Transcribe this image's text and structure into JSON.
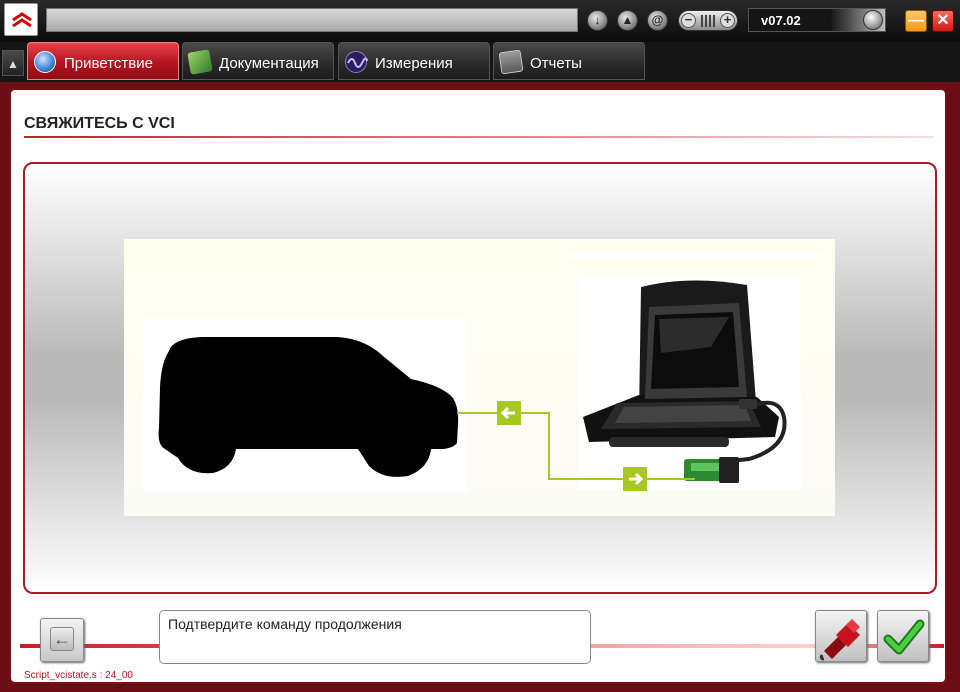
{
  "app": {
    "title_field": "",
    "version": "v07.02",
    "toolbar_icons": [
      "download-icon",
      "rocket-icon",
      "at-icon",
      "volume-icon",
      "settings-knob-icon"
    ],
    "minimize_glyph": "—",
    "close_glyph": "✕"
  },
  "tabs": [
    {
      "label": "Приветствие",
      "icon": "globe-icon",
      "active": true
    },
    {
      "label": "Документация",
      "icon": "book-icon",
      "active": false
    },
    {
      "label": "Измерения",
      "icon": "wave-icon",
      "active": false
    },
    {
      "label": "Отчеты",
      "icon": "clipboard-icon",
      "active": false
    }
  ],
  "page": {
    "title": "СВЯЖИТЕСЬ С VCI",
    "illustration": {
      "elements": [
        "vehicle-silhouette",
        "laptop-with-vci-cable",
        "arrow-left-icon",
        "arrow-right-icon"
      ]
    }
  },
  "footer": {
    "message": "Подтвердите команду продолжения",
    "script_label": "Script_vcistate.s : 24_00"
  },
  "colors": {
    "accent": "#b51520",
    "frame": "#6b0d12",
    "arrow": "#a6c823"
  }
}
